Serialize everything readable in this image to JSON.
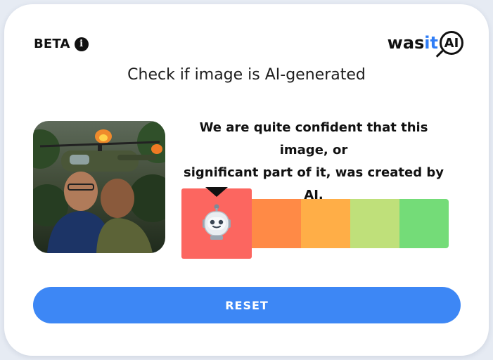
{
  "header": {
    "beta_label": "BETA",
    "info_icon": "info-icon",
    "logo": {
      "part1": "was",
      "part2": "it",
      "part3": "AI"
    }
  },
  "title": "Check if image is AI-generated",
  "result": {
    "verdict_line1": "We are quite confident that this image, or",
    "verdict_line2": "significant part of it, was created by AI.",
    "active_level": 1,
    "level_count": 5,
    "active_icon": "robot-icon",
    "colors": [
      "#fc6660",
      "#ff8a46",
      "#ffae47",
      "#bfe07a",
      "#74dc78"
    ]
  },
  "thumbnail": {
    "icon": "uploaded-image"
  },
  "actions": {
    "reset_label": "RESET"
  },
  "colors": {
    "accent": "#3d87f5",
    "background": "#e6ebf3",
    "card": "#ffffff"
  }
}
